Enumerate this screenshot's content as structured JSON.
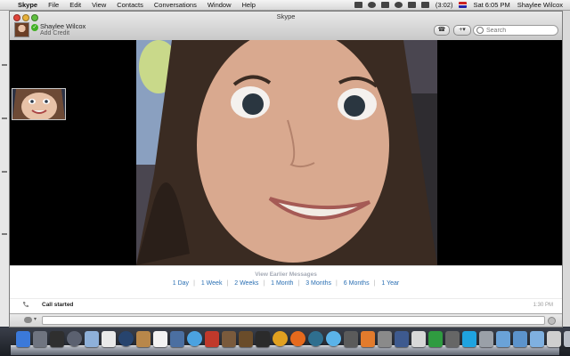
{
  "menubar": {
    "apple_glyph": "",
    "app_menu": "Skype",
    "menus": [
      "File",
      "Edit",
      "View",
      "Contacts",
      "Conversations",
      "Window",
      "Help"
    ],
    "battery_time": "(3:02)",
    "clock": "Sat 6:05 PM",
    "user_name": "Shaylee Wilcox"
  },
  "window": {
    "title": "Skype",
    "profile_name": "Shaylee Wilcox",
    "add_credit": "Add Credit",
    "online_glyph": "✓",
    "phone_button_glyph": "☎",
    "add_button_glyph": "+▾",
    "search_placeholder": "Search"
  },
  "history": {
    "view_earlier": "View Earlier Messages",
    "periods": [
      "1 Day",
      "1 Week",
      "2 Weeks",
      "1 Month",
      "3 Months",
      "6 Months",
      "1 Year"
    ],
    "call_event": "Call started",
    "call_time": "1:30 PM"
  },
  "input": {
    "message_value": "",
    "chat_caret": "▾"
  },
  "dock": {
    "icons": [
      {
        "name": "finder-icon",
        "color": "#3b79d9"
      },
      {
        "name": "system-preferences-icon",
        "color": "#6f7480"
      },
      {
        "name": "dashboard-icon",
        "color": "#2f2f2f"
      },
      {
        "name": "time-machine-icon",
        "color": "#5b6170"
      },
      {
        "name": "preview-icon",
        "color": "#8eb0d9"
      },
      {
        "name": "screenshot-icon",
        "color": "#e9e9e9"
      },
      {
        "name": "quicktime-icon",
        "color": "#27446e"
      },
      {
        "name": "address-book-icon",
        "color": "#b8874a"
      },
      {
        "name": "ical-icon",
        "color": "#f3f3f3"
      },
      {
        "name": "iphoto-icon",
        "color": "#4b6fa1"
      },
      {
        "name": "itunes-icon",
        "color": "#4ba2e0"
      },
      {
        "name": "photo-booth-icon",
        "color": "#c0392b"
      },
      {
        "name": "iphoto-album-icon",
        "color": "#7a5a3c"
      },
      {
        "name": "imovie-icon",
        "color": "#6a4c2a"
      },
      {
        "name": "garageband-icon",
        "color": "#2b2b2b"
      },
      {
        "name": "chrome-icon",
        "color": "#e0a020"
      },
      {
        "name": "firefox-icon",
        "color": "#e66a1d"
      },
      {
        "name": "network-icon",
        "color": "#2f6f8f"
      },
      {
        "name": "safari-icon",
        "color": "#5bb3e8"
      },
      {
        "name": "terminal-icon",
        "color": "#5b5b5b"
      },
      {
        "name": "presentation-icon",
        "color": "#e27b2c"
      },
      {
        "name": "photos-icon",
        "color": "#8a8a8a"
      },
      {
        "name": "utility-icon",
        "color": "#3e5a8f"
      },
      {
        "name": "mail-icon",
        "color": "#d8d8d8"
      },
      {
        "name": "evernote-icon",
        "color": "#2f9b40"
      },
      {
        "name": "mirror-icon",
        "color": "#666"
      },
      {
        "name": "skype-icon",
        "color": "#1fa3e0"
      },
      {
        "name": "archive-icon",
        "color": "#9aa0a8"
      },
      {
        "name": "folder-icon",
        "color": "#6aa2d8"
      },
      {
        "name": "downloads-folder-icon",
        "color": "#5c93cc"
      },
      {
        "name": "documents-folder-icon",
        "color": "#7fb0e0"
      },
      {
        "name": "settings-gear-icon",
        "color": "#cfcfcf"
      },
      {
        "name": "trash-icon",
        "color": "#b8bec7"
      }
    ]
  }
}
